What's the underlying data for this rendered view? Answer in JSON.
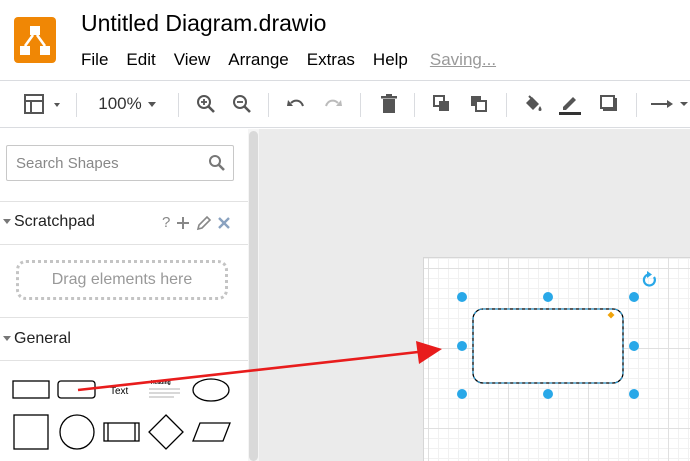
{
  "app": {
    "title": "Untitled Diagram.drawio",
    "status": "Saving..."
  },
  "menu": {
    "items": [
      "File",
      "Edit",
      "View",
      "Arrange",
      "Extras",
      "Help"
    ]
  },
  "toolbar": {
    "zoom": "100%",
    "buttons": [
      "format-panel-icon",
      "zoom-in-icon",
      "zoom-out-icon",
      "undo-icon",
      "redo-icon",
      "delete-icon",
      "to-front-icon",
      "to-back-icon",
      "fill-color-icon",
      "line-color-icon",
      "shadow-icon",
      "connection-arrow-icon"
    ]
  },
  "sidebar": {
    "search": {
      "placeholder": "Search Shapes",
      "value": ""
    },
    "scratchpad": {
      "title": "Scratchpad",
      "help": "?",
      "drop_hint": "Drag elements here"
    },
    "general": {
      "title": "General",
      "text_shape_label": "Text",
      "textbox_heading": "Heading"
    }
  },
  "colors": {
    "brand": "#f08705",
    "selection_handle": "#29a8e8",
    "arrow": "#e81c1c",
    "resize_handle": "#f0a30a"
  }
}
